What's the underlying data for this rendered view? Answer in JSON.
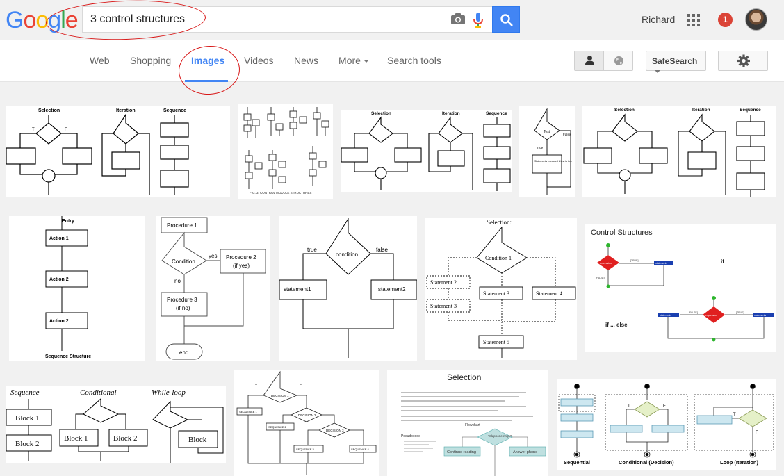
{
  "header": {
    "logo": [
      "G",
      "o",
      "o",
      "g",
      "l",
      "e"
    ],
    "search_query": "3 control structures",
    "user_name": "Richard",
    "notification_count": "1"
  },
  "nav": {
    "tabs": [
      "Web",
      "Shopping",
      "Images",
      "Videos",
      "News",
      "More",
      "Search tools"
    ],
    "active_tab": "Images",
    "safesearch_label": "SafeSearch"
  },
  "icons": [
    "camera-icon",
    "microphone-icon",
    "search-icon",
    "apps-grid-icon",
    "person-icon",
    "globe-icon",
    "gear-icon",
    "chevron-down-icon"
  ],
  "colors": {
    "brand_blue": "#4285f4",
    "notification_red": "#db4437",
    "annotation_red": "#d81818"
  },
  "results": {
    "r1": {
      "selection": "Selection",
      "iteration": "Iteration",
      "sequence": "Sequence",
      "t": "T",
      "f": "F"
    },
    "r2": {
      "caption": "FIG. 3.   CONTROL MODULE STRUCTURES"
    },
    "r4": {
      "test": "Test",
      "false": "False",
      "true": "True",
      "stmt": "Statements executed if test is true"
    },
    "r6": {
      "entry": "Entry",
      "a1": "Action 1",
      "a2": "Action 2",
      "a3": "Action 2",
      "caption": "Sequence Structure"
    },
    "r7": {
      "p1": "Procedure 1",
      "cond": "Condition",
      "yes": "yes",
      "no": "no",
      "p2": "Procedure 2",
      "p2b": "(if yes)",
      "p3": "Procedure 3",
      "p3b": "(if no)",
      "end": "end"
    },
    "r8": {
      "cond": "condition",
      "true": "true",
      "false": "false",
      "s1": "statement1",
      "s2": "statement2"
    },
    "r9": {
      "title": "Selection:",
      "cond": "Condition 1",
      "s2": "Statement 2",
      "s3a": "Statement 3",
      "s3b": "Statement 3",
      "s4": "Statement 4",
      "s5": "Statement 5"
    },
    "r10": {
      "title": "Control Structures",
      "expr": "expression",
      "true": "[TRUE]",
      "false": "[FALSE]",
      "stmts": "statements",
      "if": "if",
      "ifelse": "if ... else"
    },
    "r11": {
      "seq": "Sequence",
      "cond": "Conditional",
      "loop": "While-loop",
      "b1": "Block 1",
      "b2": "Block 2",
      "b1c": "Block 1",
      "b2c": "Block 2",
      "block": "Block"
    },
    "r12": {
      "d1": "DECISION 1",
      "d2": "DECISION 2",
      "d3": "DECISION 3",
      "s1": "SEQUENCE 1",
      "s2": "SEQUENCE 2",
      "s3": "SEQUENCE 3",
      "s4": "SEQUENCE 4",
      "t": "T",
      "f": "F"
    },
    "r13": {
      "title": "Selection",
      "pseudo": "Pseudocode",
      "flow": "Flowchart",
      "phone": "Telephone rings?",
      "reading": "Continue reading",
      "answer": "Answer phone"
    },
    "r14": {
      "seq": "Sequential",
      "cond": "Conditional (Decision)",
      "loop": "Loop (Iteration)",
      "t": "T",
      "f": "F"
    }
  }
}
